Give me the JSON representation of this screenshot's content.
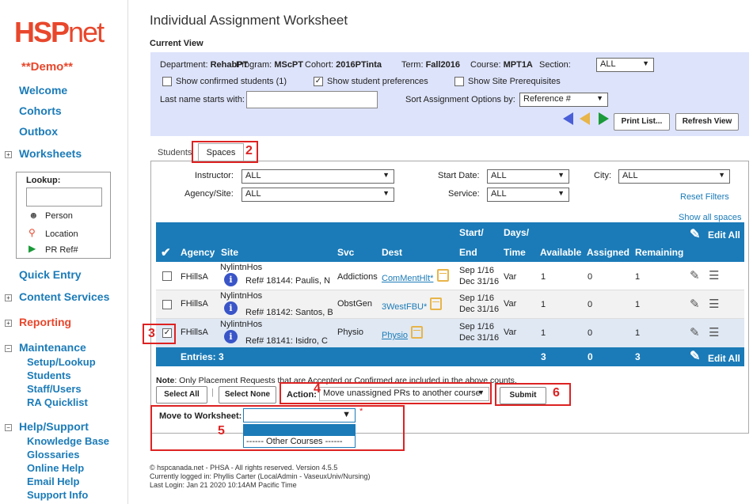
{
  "sidebar": {
    "logo_hsp": "HSP",
    "logo_net": "net",
    "demo": "**Demo**",
    "welcome": "Welcome",
    "cohorts": "Cohorts",
    "outbox": "Outbox",
    "worksheets": "Worksheets",
    "lookup_title": "Lookup:",
    "person": "Person",
    "location": "Location",
    "pr_ref": "PR Ref#",
    "quick_entry": "Quick Entry",
    "content_services": "Content Services",
    "reporting": "Reporting",
    "maintenance": "Maintenance",
    "setup_lookup": "Setup/Lookup",
    "students": "Students",
    "staff_users": "Staff/Users",
    "ra_quicklist": "RA Quicklist",
    "help_support": "Help/Support",
    "knowledge_base": "Knowledge Base",
    "glossaries": "Glossaries",
    "online_help": "Online Help",
    "email_help": "Email Help",
    "support_info": "Support Info"
  },
  "page_title": "Individual Assignment Worksheet",
  "current_view": {
    "label": "Current View",
    "department_label": "Department:",
    "department": "RehabPT",
    "program_label": "Program:",
    "program": "MScPT",
    "cohort_label": "Cohort:",
    "cohort": "2016PTinta",
    "term_label": "Term:",
    "term": "Fall2016",
    "course_label": "Course:",
    "course": "MPT1A",
    "section_label": "Section:",
    "section": "ALL",
    "show_confirmed": "Show confirmed students (1)",
    "show_preferences": "Show student preferences",
    "show_prereq": "Show Site Prerequisites",
    "lastname_label": "Last name starts with:",
    "sort_label": "Sort Assignment Options by:",
    "sort_value": "Reference #",
    "print_list": "Print List...",
    "refresh_view": "Refresh View"
  },
  "tabs": {
    "students": "Students",
    "spaces": "Spaces"
  },
  "filters": {
    "instructor_label": "Instructor:",
    "instructor": "ALL",
    "agency_label": "Agency/Site:",
    "agency": "ALL",
    "start_label": "Start Date:",
    "start": "ALL",
    "service_label": "Service:",
    "service": "ALL",
    "city_label": "City:",
    "city": "ALL",
    "reset": "Reset Filters",
    "show_all": "Show all spaces"
  },
  "table": {
    "headers": {
      "agency": "Agency",
      "site": "Site",
      "svc": "Svc",
      "dest": "Dest",
      "start": "Start/",
      "end": "End",
      "days": "Days/",
      "time": "Time",
      "available": "Available",
      "assigned": "Assigned",
      "remaining": "Remaining",
      "edit_all": "Edit All"
    },
    "rows": [
      {
        "agency": "FHillsA",
        "site": "NylintnHos",
        "ref": "Ref# 18144: Paulis, N",
        "svc": "Addictions",
        "dest": "ComMentHlt*",
        "start": "Sep 1/16",
        "end": "Dec 31/16",
        "time": "Var",
        "available": "1",
        "assigned": "0",
        "remaining": "1"
      },
      {
        "agency": "FHillsA",
        "site": "NylintnHos",
        "ref": "Ref# 18142: Santos, B",
        "svc": "ObstGen",
        "dest": "3WestFBU*",
        "start": "Sep 1/16",
        "end": "Dec 31/16",
        "time": "Var",
        "available": "1",
        "assigned": "0",
        "remaining": "1"
      },
      {
        "agency": "FHillsA",
        "site": "NylintnHos",
        "ref": "Ref# 18141: Isidro, C",
        "svc": "Physio",
        "dest": "Physio",
        "start": "Sep 1/16",
        "end": "Dec 31/16",
        "time": "Var",
        "available": "1",
        "assigned": "0",
        "remaining": "1"
      }
    ],
    "footer": {
      "entries": "Entries: 3",
      "available": "3",
      "assigned": "0",
      "remaining": "3",
      "edit_all": "Edit All"
    }
  },
  "actions": {
    "note_bold": "Note",
    "note_text": ": Only Placement Requests that are Accepted or Confirmed are included in the above counts.",
    "select_all": "Select All",
    "select_none": "Select None",
    "action_label": "Action:",
    "action_value": "Move unassigned PRs to another course",
    "submit": "Submit",
    "move_label": "Move to Worksheet:",
    "required": "*",
    "dropdown_option": "------ Other Courses ------"
  },
  "annotations": [
    "2",
    "3",
    "4",
    "5",
    "6"
  ],
  "footer": {
    "line1": "© hspcanada.net - PHSA - All rights reserved.    Version 4.5.5",
    "line2": "Currently logged in: Phyllis Carter (LocalAdmin - VaseuxUniv/Nursing)",
    "line3": "Last Login: Jan 21 2020 10:14AM Pacific Time"
  }
}
